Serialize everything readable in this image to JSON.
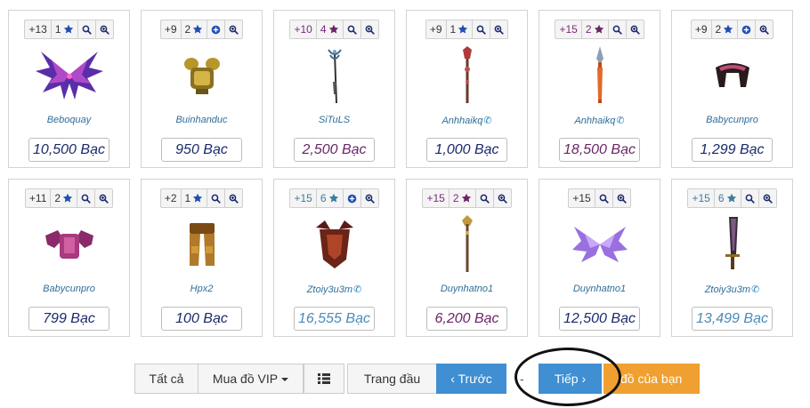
{
  "items": [
    {
      "badges": [
        "+13",
        "1"
      ],
      "star_color": "#1f4fb5",
      "extra": "search",
      "seller": "Beboquay",
      "phone": false,
      "price": "10,500 Bạc",
      "price_style": "blue",
      "lvl_style": "lo",
      "art": "wings-purple"
    },
    {
      "badges": [
        "+9",
        "2"
      ],
      "star_color": "#1f4fb5",
      "extra": "plus",
      "seller": "Buinhanduc",
      "phone": false,
      "price": "950 Bạc",
      "price_style": "blue",
      "lvl_style": "lo",
      "art": "armor-gold"
    },
    {
      "badges": [
        "+10",
        "4"
      ],
      "star_color": "#6b2566",
      "extra": "search",
      "seller": "SiTuLS",
      "phone": false,
      "price": "2,500 Bạc",
      "price_style": "purple",
      "lvl_style": "hi",
      "art": "staff-dark"
    },
    {
      "badges": [
        "+9",
        "1"
      ],
      "star_color": "#1f4fb5",
      "extra": "search",
      "seller": "Anhhaikq",
      "phone": true,
      "price": "1,000 Bạc",
      "price_style": "blue",
      "lvl_style": "lo",
      "art": "staff-red"
    },
    {
      "badges": [
        "+15",
        "2"
      ],
      "star_color": "#6b2566",
      "extra": "search",
      "seller": "Anhhaikq",
      "phone": true,
      "price": "18,500 Bạc",
      "price_style": "purple",
      "lvl_style": "hi",
      "art": "spear-orange"
    },
    {
      "badges": [
        "+9",
        "2"
      ],
      "star_color": "#1f4fb5",
      "extra": "plus",
      "seller": "Babycunpro",
      "phone": false,
      "price": "1,299 Bạc",
      "price_style": "blue",
      "lvl_style": "lo",
      "art": "shoulder-dark"
    },
    {
      "badges": [
        "+11",
        "2"
      ],
      "star_color": "#1f4fb5",
      "extra": "search",
      "seller": "Babycunpro",
      "phone": false,
      "price": "799 Bạc",
      "price_style": "blue",
      "lvl_style": "lo",
      "art": "armor-pink"
    },
    {
      "badges": [
        "+2",
        "1"
      ],
      "star_color": "#1f4fb5",
      "extra": "search",
      "seller": "Hpx2",
      "phone": false,
      "price": "100 Bạc",
      "price_style": "blue",
      "lvl_style": "lo",
      "art": "pants-gold"
    },
    {
      "badges": [
        "+15",
        "6"
      ],
      "star_color": "#3a7ea0",
      "extra": "plus",
      "seller": "Ztoiy3u3m",
      "phone": true,
      "price": "16,555 Bạc",
      "price_style": "lightblue",
      "lvl_style": "teal",
      "art": "armor-red"
    },
    {
      "badges": [
        "+15",
        "2"
      ],
      "star_color": "#6b2566",
      "extra": "search",
      "seller": "Duynhatno1",
      "phone": false,
      "price": "6,200 Bạc",
      "price_style": "purple",
      "lvl_style": "hi",
      "art": "staff-gold"
    },
    {
      "badges": [
        "+15"
      ],
      "star_color": "",
      "extra": "search",
      "seller": "Duynhatno1",
      "phone": false,
      "price": "12,500 Bạc",
      "price_style": "blue",
      "lvl_style": "lo",
      "art": "wings-violet"
    },
    {
      "badges": [
        "+15",
        "6"
      ],
      "star_color": "#3a7ea0",
      "extra": "search",
      "seller": "Ztoiy3u3m",
      "phone": true,
      "price": "13,499 Bạc",
      "price_style": "lightblue",
      "lvl_style": "teal",
      "art": "sword-dark"
    }
  ],
  "pager": {
    "all": "Tất cả",
    "vip": "Mua đồ VIP",
    "first": "Trang đầu",
    "prev": "‹ Trước",
    "sep": "-",
    "next": "Tiếp ›",
    "mine": "đồ của bạn"
  },
  "colors": {
    "accent": "#3f8fd2",
    "orange": "#f0a030"
  }
}
